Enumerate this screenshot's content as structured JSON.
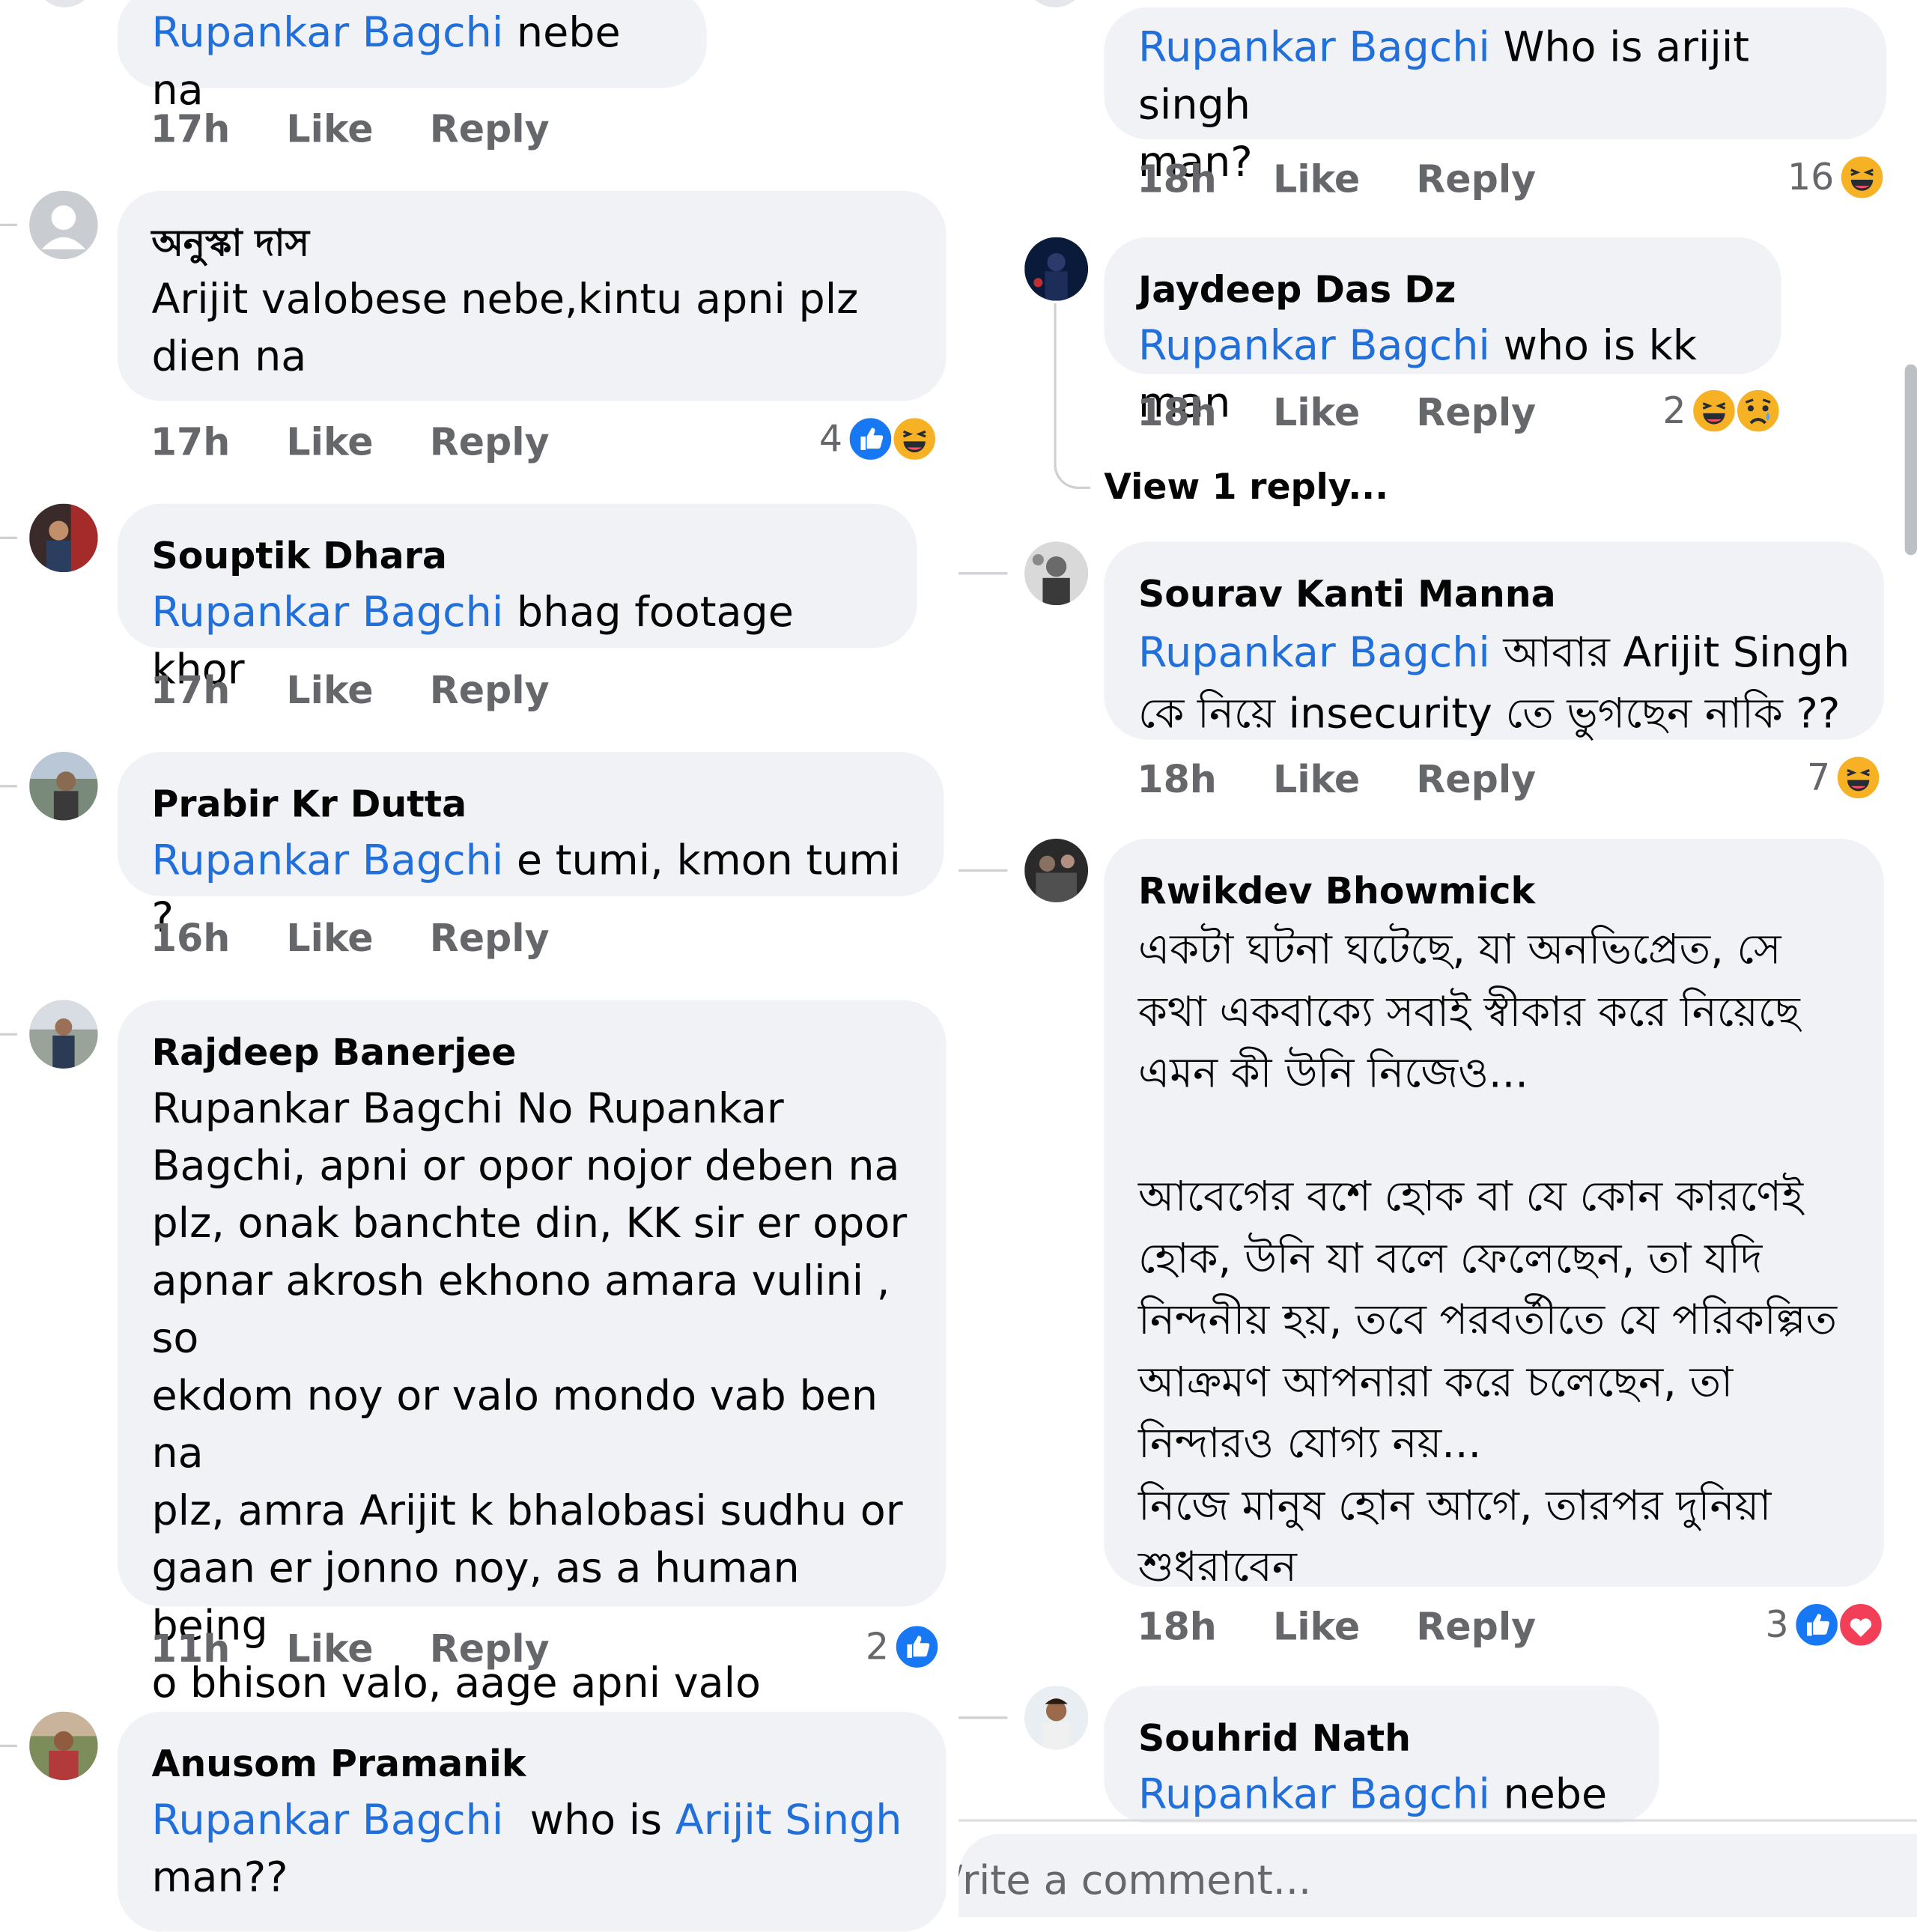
{
  "left_column": [
    {
      "id": "c1",
      "author": "",
      "mention": "Rupankar Bagchi",
      "text": " nebe na",
      "time": "17h",
      "like": "Like",
      "reply": "Reply",
      "reaction_count": "",
      "reactions": []
    },
    {
      "id": "c2",
      "author": "অনুস্কা দাস",
      "mention": "",
      "text": "Arijit valobese nebe,kintu apni plz\ndien na",
      "time": "17h",
      "like": "Like",
      "reply": "Reply",
      "reaction_count": "4",
      "reactions": [
        "like-icon",
        "haha-icon"
      ]
    },
    {
      "id": "c3",
      "author": "Souptik Dhara",
      "mention": "Rupankar Bagchi",
      "text": " bhag footage khor",
      "time": "17h",
      "like": "Like",
      "reply": "Reply",
      "reaction_count": "",
      "reactions": []
    },
    {
      "id": "c4",
      "author": "Prabir Kr Dutta",
      "mention": "Rupankar Bagchi",
      "text": " e tumi, kmon tumi ?",
      "time": "16h",
      "like": "Like",
      "reply": "Reply",
      "reaction_count": "",
      "reactions": []
    },
    {
      "id": "c5",
      "author": "Rajdeep Banerjee",
      "mention": "",
      "text": "Rupankar Bagchi No Rupankar\nBagchi, apni or opor nojor deben na\nplz, onak banchte din, KK sir er opor\napnar akrosh ekhono amara vulini , so\nekdom noy or valo mondo vab ben na\nplz, amra Arijit k bhalobasi sudhu or\ngaan er jonno noy, as a human being\no bhison valo, aage apni valo manush\nhon tar por toh valo gayak hoben.",
      "time": "11h",
      "like": "Like",
      "reply": "Reply",
      "reaction_count": "2",
      "reactions": [
        "like-icon"
      ]
    },
    {
      "id": "c6",
      "author": "Anusom Pramanik",
      "mention": "Rupankar Bagchi",
      "text": "  who is ",
      "mention2": "Arijit Singh",
      "text2": "\nman??",
      "time": "",
      "like": "",
      "reply": "",
      "reaction_count": "",
      "reactions": []
    }
  ],
  "right_column": [
    {
      "id": "r1",
      "author": "",
      "mention": "Rupankar Bagchi",
      "text": " Who is arijit singh\nman?",
      "time": "18h",
      "like": "Like",
      "reply": "Reply",
      "reaction_count": "16",
      "reactions": [
        "haha-icon"
      ]
    },
    {
      "id": "r2",
      "author": "Jaydeep Das Dz",
      "mention": "Rupankar Bagchi",
      "text": " who is kk man",
      "time": "18h",
      "like": "Like",
      "reply": "Reply",
      "reaction_count": "2",
      "reactions": [
        "haha-icon",
        "sad-icon"
      ],
      "view_replies": "View 1 reply..."
    },
    {
      "id": "r3",
      "author": "Sourav Kanti Manna",
      "mention": "Rupankar Bagchi",
      "text": " আবার Arijit Singh\nকে নিয়ে insecurity তে ভুগছেন নাকি ??",
      "time": "18h",
      "like": "Like",
      "reply": "Reply",
      "reaction_count": "7",
      "reactions": [
        "haha-icon"
      ]
    },
    {
      "id": "r4",
      "author": "Rwikdev Bhowmick",
      "mention": "",
      "text": "একটা ঘটনা ঘটেছে, যা অনভিপ্রেত, সে\nকথা একবাক্যে সবাই স্বীকার করে নিয়েছে\nএমন কী উনি নিজেও...\n\nআবেগের বশে হোক বা যে কোন কারণেই\nহোক, উনি যা বলে ফেলেছেন, তা যদি\nনিন্দনীয় হয়, তবে পরবর্তীতে যে পরিকল্পিত\nআক্রমণ আপনারা করে চলেছেন, তা\nনিন্দারও যোগ্য নয়...\nনিজে মানুষ হোন আগে, তারপর দুনিয়া\nশুধরাবেন",
      "time": "18h",
      "like": "Like",
      "reply": "Reply",
      "reaction_count": "3",
      "reactions": [
        "like-icon",
        "love-icon"
      ]
    },
    {
      "id": "r5",
      "author": "Souhrid Nath",
      "mention": "Rupankar Bagchi",
      "text": " nebe na",
      "time": "",
      "like": "",
      "reply": "",
      "reaction_count": "",
      "reactions": []
    }
  ],
  "composer": {
    "placeholder": "/rite a comment..."
  },
  "colors": {
    "mention": "#216fdb",
    "bubble": "#f0f2f5",
    "meta": "#65676b",
    "like_blue": "#1877f2",
    "haha_yellow": "#f7b125",
    "love_red": "#f33e58"
  }
}
